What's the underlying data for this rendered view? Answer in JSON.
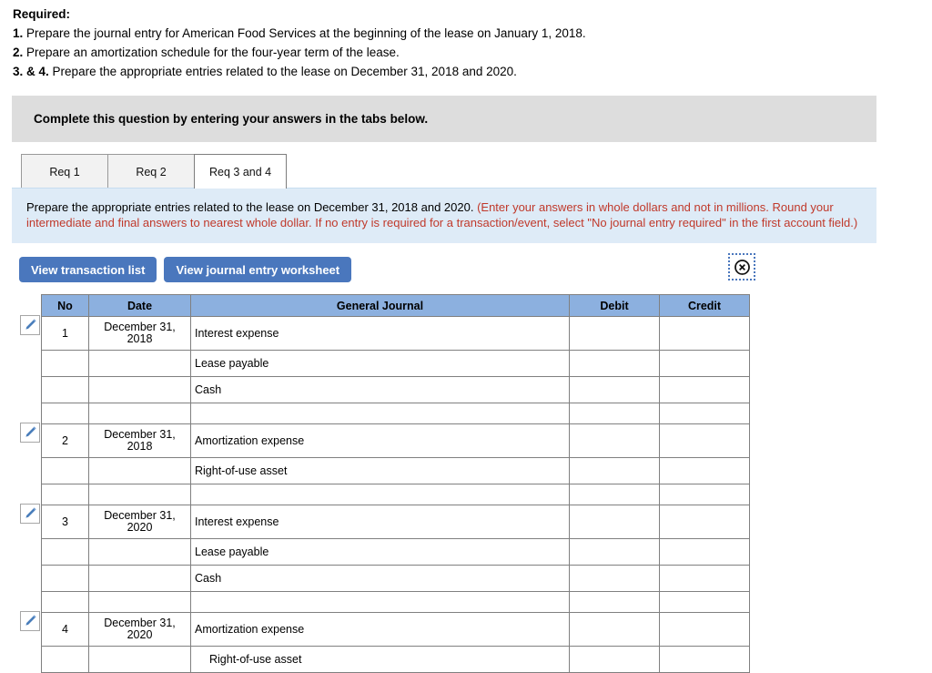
{
  "required": {
    "title": "Required:",
    "items": [
      {
        "num": "1.",
        "text": "Prepare the journal entry for American Food Services at the beginning of the lease on January 1, 2018."
      },
      {
        "num": "2.",
        "text": "Prepare an amortization schedule for the four-year term of the lease."
      },
      {
        "num": "3. & 4.",
        "text": "Prepare the appropriate entries related to the lease on December 31, 2018 and 2020."
      }
    ]
  },
  "complete_bar": {
    "text": "Complete this question by entering your answers in the tabs below."
  },
  "tabs": [
    {
      "label": "Req 1",
      "active": false
    },
    {
      "label": "Req 2",
      "active": false
    },
    {
      "label": "Req 3 and 4",
      "active": true
    }
  ],
  "instruction": {
    "black_text": "Prepare the appropriate entries related to the lease on December 31, 2018 and 2020. ",
    "red_text": "(Enter your answers in whole dollars and not in millions. Round your intermediate and final answers to nearest whole dollar. If no entry is required for a transaction/event, select \"No journal entry required\" in the first account field.)"
  },
  "actions": {
    "view_transaction_list": "View transaction list",
    "view_journal_entry_worksheet": "View journal entry worksheet",
    "close_icon": "circle-x-icon"
  },
  "colors": {
    "button_blue": "#4a77bd",
    "header_blue": "#8cb0df",
    "panel_blue": "#deebf7",
    "bar_gray": "#dddddd",
    "red_text": "#c0392b",
    "pencil_blue": "#4a7ebb"
  },
  "journal_table": {
    "columns": [
      "No",
      "Date",
      "General Journal",
      "Debit",
      "Credit"
    ],
    "rows": [
      {
        "no": "1",
        "date": "December 31, 2018",
        "account": "Interest expense",
        "debit": "",
        "credit": "",
        "first": true,
        "indent": false,
        "blank": false
      },
      {
        "no": "",
        "date": "",
        "account": "Lease payable",
        "debit": "",
        "credit": "",
        "first": false,
        "indent": false,
        "blank": false
      },
      {
        "no": "",
        "date": "",
        "account": "Cash",
        "debit": "",
        "credit": "",
        "first": false,
        "indent": false,
        "blank": false
      },
      {
        "no": "",
        "date": "",
        "account": "",
        "debit": "",
        "credit": "",
        "first": false,
        "indent": false,
        "blank": true
      },
      {
        "no": "2",
        "date": "December 31, 2018",
        "account": "Amortization expense",
        "debit": "",
        "credit": "",
        "first": true,
        "indent": false,
        "blank": false
      },
      {
        "no": "",
        "date": "",
        "account": "Right-of-use asset",
        "debit": "",
        "credit": "",
        "first": false,
        "indent": false,
        "blank": false
      },
      {
        "no": "",
        "date": "",
        "account": "",
        "debit": "",
        "credit": "",
        "first": false,
        "indent": false,
        "blank": true
      },
      {
        "no": "3",
        "date": "December 31, 2020",
        "account": "Interest expense",
        "debit": "",
        "credit": "",
        "first": true,
        "indent": false,
        "blank": false
      },
      {
        "no": "",
        "date": "",
        "account": "Lease payable",
        "debit": "",
        "credit": "",
        "first": false,
        "indent": false,
        "blank": false
      },
      {
        "no": "",
        "date": "",
        "account": "Cash",
        "debit": "",
        "credit": "",
        "first": false,
        "indent": false,
        "blank": false
      },
      {
        "no": "",
        "date": "",
        "account": "",
        "debit": "",
        "credit": "",
        "first": false,
        "indent": false,
        "blank": true
      },
      {
        "no": "4",
        "date": "December 31, 2020",
        "account": "Amortization expense",
        "debit": "",
        "credit": "",
        "first": true,
        "indent": false,
        "blank": false
      },
      {
        "no": "",
        "date": "",
        "account": "Right-of-use asset",
        "debit": "",
        "credit": "",
        "first": false,
        "indent": true,
        "blank": false
      }
    ]
  }
}
